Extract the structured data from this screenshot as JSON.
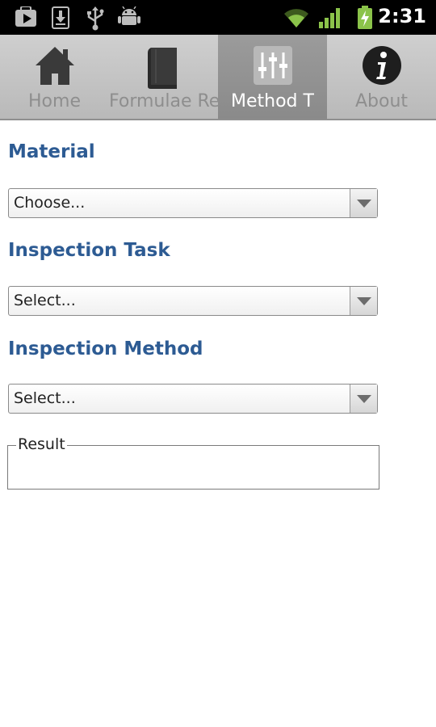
{
  "status_bar": {
    "time": "2:31",
    "icons": [
      "play-store-icon",
      "download-icon",
      "usb-icon",
      "android-icon",
      "wifi-icon",
      "signal-icon",
      "battery-icon"
    ]
  },
  "tabs": [
    {
      "label": "Home",
      "icon": "home-icon",
      "active": false
    },
    {
      "label": "Formulae Re",
      "icon": "book-icon",
      "active": false
    },
    {
      "label": "Method T",
      "icon": "sliders-icon",
      "active": true
    },
    {
      "label": "About",
      "icon": "info-icon",
      "active": false
    }
  ],
  "form": {
    "material": {
      "label": "Material",
      "value": "Choose..."
    },
    "inspection_task": {
      "label": "Inspection Task",
      "value": "Select..."
    },
    "inspection_method": {
      "label": "Inspection Method",
      "value": "Select..."
    },
    "result": {
      "legend": "Result",
      "value": ""
    }
  },
  "colors": {
    "label_blue": "#2d5b93",
    "tab_bar": "#c4c4c4",
    "active_tab": "#939393",
    "status_bar": "#000000"
  }
}
